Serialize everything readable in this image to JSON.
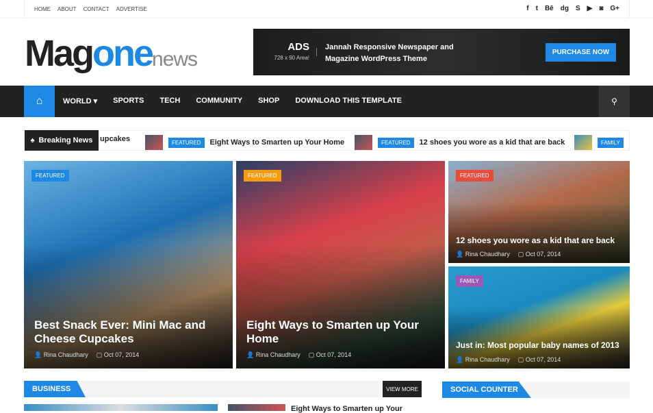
{
  "topbar": {
    "links": [
      "HOME",
      "ABOUT",
      "CONTACT",
      "ADVERTISE"
    ],
    "social_icons": [
      "facebook-icon",
      "twitter-icon",
      "behance-icon",
      "digg-icon",
      "skype-icon",
      "youtube-icon",
      "instagram-icon",
      "google-plus-icon"
    ],
    "social_glyphs": [
      "f",
      "t",
      "Bē",
      "dg",
      "S",
      "▶",
      "◙",
      "G+"
    ]
  },
  "logo": {
    "part1": "Mag",
    "part2": "one",
    "part3": "news"
  },
  "ad": {
    "title": "ADS",
    "size": "728 x 90 Area!",
    "text": "Jannah Responsive Newspaper and Magazine WordPress Theme",
    "button": "PURCHASE NOW"
  },
  "nav": {
    "items": [
      "WORLD ▾",
      "SPORTS",
      "TECH",
      "COMMUNITY",
      "SHOP",
      "DOWNLOAD THIS TEMPLATE"
    ]
  },
  "ticker": {
    "label": "Breaking News",
    "items": [
      {
        "title": "upcakes"
      },
      {
        "tag": "FEATURED",
        "title": "Eight Ways to Smarten up Your Home"
      },
      {
        "tag": "FEATURED",
        "title": "12 shoes you wore as a kid that are back"
      },
      {
        "tag": "FAMILY",
        "title": ""
      }
    ]
  },
  "featured": [
    {
      "tag": "FEATURED",
      "tag_color": "#1e88e5",
      "title": "Best Snack Ever: Mini Mac and Cheese Cupcakes",
      "author": "Rina Chaudhary",
      "date": "Oct 07, 2014"
    },
    {
      "tag": "FEATURED",
      "tag_color": "#f39c12",
      "title": "Eight Ways to Smarten up Your Home",
      "author": "Rina Chaudhary",
      "date": "Oct 07, 2014"
    },
    {
      "tag": "FEATURED",
      "tag_color": "#e74c3c",
      "title": "12 shoes you wore as a kid that are back",
      "author": "Rina Chaudhary",
      "date": "Oct 07, 2014"
    },
    {
      "tag": "FAMILY",
      "tag_color": "#9b59b6",
      "title": "Just in: Most popular baby names of 2013",
      "author": "Rina Chaudhary",
      "date": "Oct 07, 2014"
    }
  ],
  "business": {
    "title": "BUSINESS",
    "view_more": "VIEW MORE",
    "list_title": "Eight Ways to Smarten up Your"
  },
  "social_counter": {
    "title": "SOCIAL COUNTER"
  }
}
